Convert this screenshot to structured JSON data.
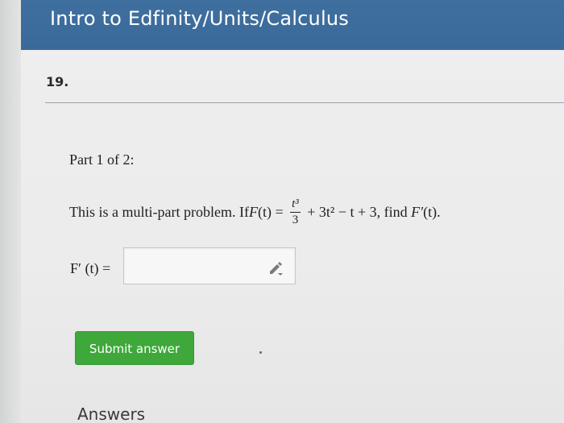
{
  "header": {
    "title": "Intro to Edfinity/Units/Calculus"
  },
  "question": {
    "number": "19."
  },
  "part": {
    "label": "Part 1 of 2:"
  },
  "problem": {
    "prefix": "This is a multi-part problem. If ",
    "F": "F",
    "t_arg": "(t)",
    "eq": " = ",
    "frac_num": "t³",
    "frac_den": "3",
    "rest": " + 3t² − t + 3, find ",
    "Fprime": "F′",
    "t_arg2": "(t)",
    "end": "."
  },
  "answer": {
    "label": "F′ (t) =",
    "value": "",
    "placeholder": ""
  },
  "submit": {
    "label": "Submit answer"
  },
  "answers_section": {
    "heading": "Answers"
  },
  "icons": {
    "edit": "pencil-icon"
  },
  "colors": {
    "header_bg": "#3f6f9e",
    "submit_bg": "#3ea83a"
  }
}
